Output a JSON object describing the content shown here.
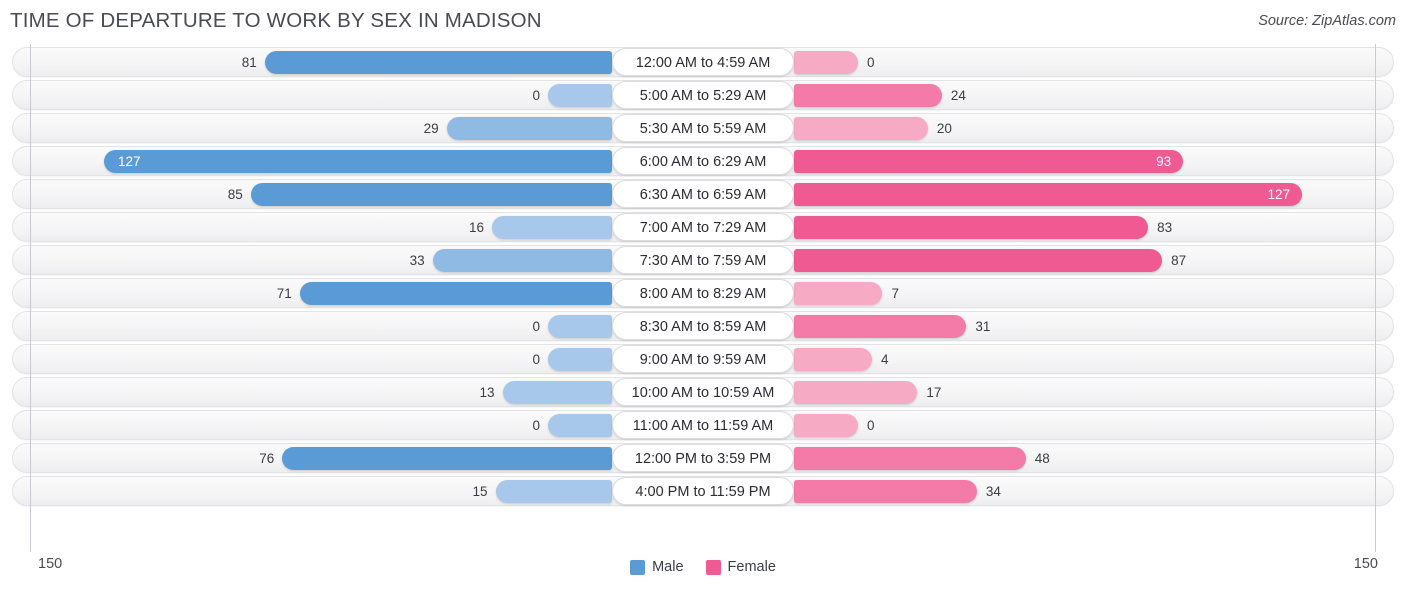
{
  "header": {
    "title": "TIME OF DEPARTURE TO WORK BY SEX IN MADISON",
    "source": "Source: ZipAtlas.com"
  },
  "legend": {
    "items": [
      {
        "label": "Male",
        "color": "#5b9bd5"
      },
      {
        "label": "Female",
        "color": "#ef5a93"
      }
    ]
  },
  "axis": {
    "left_tick": "150",
    "right_tick": "150",
    "max": 150
  },
  "colors": {
    "male_strong": "#5b9bd5",
    "male_light": "#a7c8ea",
    "female_strong": "#ef5a93",
    "female_mid": "#f47ba8",
    "female_light": "#f7aac4",
    "track": "#f5f5f6",
    "text": "#3c3c46"
  },
  "chart_data": {
    "type": "bar",
    "title": "TIME OF DEPARTURE TO WORK BY SEX IN MADISON",
    "subtitle": "",
    "xlabel": "",
    "ylabel": "",
    "orientation": "horizontal-diverging",
    "grid": false,
    "legend_position": "bottom-center",
    "xlim": [
      150,
      150
    ],
    "categories": [
      "12:00 AM to 4:59 AM",
      "5:00 AM to 5:29 AM",
      "5:30 AM to 5:59 AM",
      "6:00 AM to 6:29 AM",
      "6:30 AM to 6:59 AM",
      "7:00 AM to 7:29 AM",
      "7:30 AM to 7:59 AM",
      "8:00 AM to 8:29 AM",
      "8:30 AM to 8:59 AM",
      "9:00 AM to 9:59 AM",
      "10:00 AM to 10:59 AM",
      "11:00 AM to 11:59 AM",
      "12:00 PM to 3:59 PM",
      "4:00 PM to 11:59 PM"
    ],
    "series": [
      {
        "name": "Male",
        "values": [
          81,
          0,
          29,
          127,
          85,
          16,
          33,
          71,
          0,
          0,
          13,
          0,
          76,
          15
        ]
      },
      {
        "name": "Female",
        "values": [
          0,
          24,
          20,
          93,
          127,
          83,
          87,
          7,
          31,
          4,
          17,
          0,
          48,
          34
        ]
      }
    ]
  },
  "rows": [
    {
      "label": "12:00 AM to 4:59 AM",
      "male": 81,
      "female": 0,
      "male_label": "81",
      "female_label": "0"
    },
    {
      "label": "5:00 AM to 5:29 AM",
      "male": 0,
      "female": 24,
      "male_label": "0",
      "female_label": "24"
    },
    {
      "label": "5:30 AM to 5:59 AM",
      "male": 29,
      "female": 20,
      "male_label": "29",
      "female_label": "20"
    },
    {
      "label": "6:00 AM to 6:29 AM",
      "male": 127,
      "female": 93,
      "male_label": "127",
      "female_label": "93"
    },
    {
      "label": "6:30 AM to 6:59 AM",
      "male": 85,
      "female": 127,
      "male_label": "85",
      "female_label": "127"
    },
    {
      "label": "7:00 AM to 7:29 AM",
      "male": 16,
      "female": 83,
      "male_label": "16",
      "female_label": "83"
    },
    {
      "label": "7:30 AM to 7:59 AM",
      "male": 33,
      "female": 87,
      "male_label": "33",
      "female_label": "87"
    },
    {
      "label": "8:00 AM to 8:29 AM",
      "male": 71,
      "female": 7,
      "male_label": "71",
      "female_label": "7"
    },
    {
      "label": "8:30 AM to 8:59 AM",
      "male": 0,
      "female": 31,
      "male_label": "0",
      "female_label": "31"
    },
    {
      "label": "9:00 AM to 9:59 AM",
      "male": 0,
      "female": 4,
      "male_label": "0",
      "female_label": "4"
    },
    {
      "label": "10:00 AM to 10:59 AM",
      "male": 13,
      "female": 17,
      "male_label": "13",
      "female_label": "17"
    },
    {
      "label": "11:00 AM to 11:59 AM",
      "male": 0,
      "female": 0,
      "male_label": "0",
      "female_label": "0"
    },
    {
      "label": "12:00 PM to 3:59 PM",
      "male": 76,
      "female": 48,
      "male_label": "76",
      "female_label": "48"
    },
    {
      "label": "4:00 PM to 11:59 PM",
      "male": 15,
      "female": 34,
      "male_label": "15",
      "female_label": "34"
    }
  ]
}
